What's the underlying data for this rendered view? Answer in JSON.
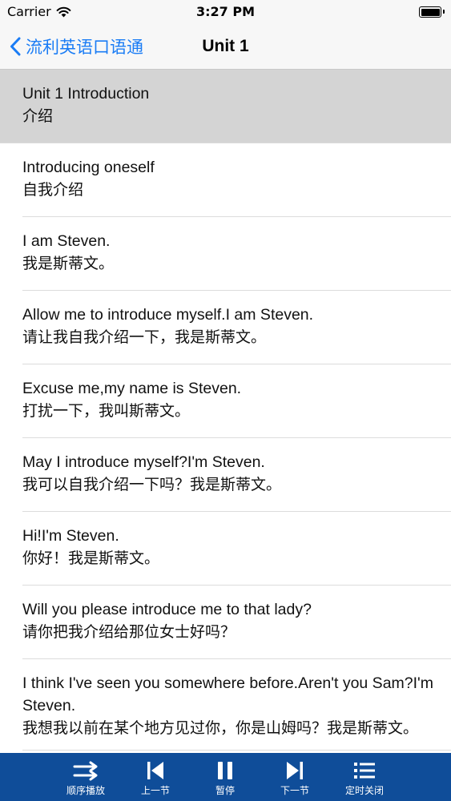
{
  "status_bar": {
    "carrier": "Carrier",
    "time": "3:27 PM",
    "wifi_icon": "wifi-icon",
    "battery_icon": "battery-icon"
  },
  "nav": {
    "back_label": "流利英语口语通",
    "title": "Unit 1",
    "accent_color": "#1a7cf5"
  },
  "list": {
    "selected_index": 0,
    "items": [
      {
        "en": "Unit 1 Introduction",
        "zh": "介绍"
      },
      {
        "en": "Introducing oneself",
        "zh": "自我介绍"
      },
      {
        "en": "I am Steven.",
        "zh": "我是斯蒂文。"
      },
      {
        "en": "Allow me to introduce myself.I am Steven.",
        "zh": "请让我自我介绍一下，我是斯蒂文。"
      },
      {
        "en": "Excuse me,my name is Steven.",
        "zh": "打扰一下，我叫斯蒂文。"
      },
      {
        "en": "May I introduce myself?I'm Steven.",
        "zh": "我可以自我介绍一下吗？我是斯蒂文。"
      },
      {
        "en": "Hi!I'm Steven.",
        "zh": "你好！我是斯蒂文。"
      },
      {
        "en": "Will you please introduce me to that lady?",
        "zh": "请你把我介绍给那位女士好吗？"
      },
      {
        "en": "I think I've seen you somewhere before.Aren't you Sam?I'm Steven.",
        "zh": "我想我以前在某个地方见过你，你是山姆吗？我是斯蒂文。"
      }
    ]
  },
  "toolbar": {
    "background_color": "#0f4d99",
    "items": [
      {
        "label": "顺序播放",
        "icon": "sequential-play-icon"
      },
      {
        "label": "上一节",
        "icon": "previous-track-icon"
      },
      {
        "label": "暂停",
        "icon": "pause-icon"
      },
      {
        "label": "下一节",
        "icon": "next-track-icon"
      },
      {
        "label": "定时关闭",
        "icon": "timer-list-icon"
      }
    ]
  }
}
